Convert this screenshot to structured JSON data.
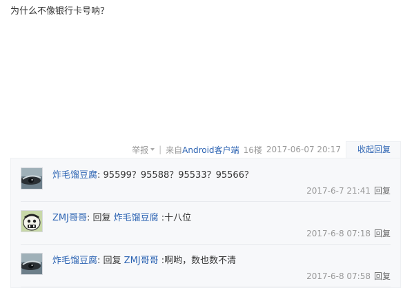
{
  "post": {
    "text": "为什么不像银行卡号呐？"
  },
  "tail": {
    "report": "举报",
    "separator": "|",
    "source_prefix": "来自",
    "source_link": "Android客户端",
    "floor": "16楼",
    "time": "2017-06-07 20:17",
    "collapse": "收起回复"
  },
  "replies": [
    {
      "user": "炸毛馏豆腐",
      "colon": ":",
      "content": " 95599？95588？95533？95566？",
      "time": "2017-6-7 21:41",
      "reply_label": "回复"
    },
    {
      "user": "ZMJ哥哥",
      "colon": ":",
      "reply_word": " 回复 ",
      "target": "炸毛馏豆腐",
      "content": " :十八位",
      "time": "2017-6-8 07:18",
      "reply_label": "回复"
    },
    {
      "user": "炸毛馏豆腐",
      "colon": ":",
      "reply_word": " 回复 ",
      "target": "ZMJ哥哥",
      "content": " :啊哟，数也数不清",
      "time": "2017-6-8 07:58",
      "reply_label": "回复"
    }
  ],
  "colors": {
    "link": "#2d64b3",
    "muted": "#999999",
    "reply_bg": "#f7f8fa"
  }
}
